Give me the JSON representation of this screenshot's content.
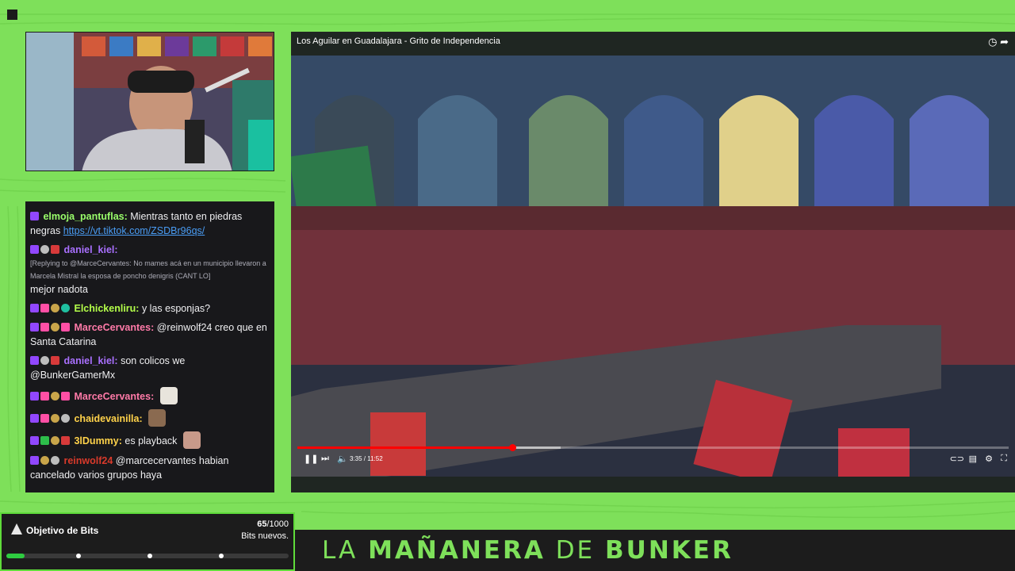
{
  "video": {
    "title": "Los Aguilar en Guadalajara - Grito de Independencia",
    "time": "3:35 / 11:52",
    "progress_fraction": 0.302,
    "buffered_fraction": 0.37
  },
  "chat": {
    "messages": [
      {
        "user": "elmoja_pantuflas:",
        "text": "Mientras tanto en piedras negras",
        "link": "https://vt.tiktok.com/ZSDBr96qs/",
        "color": "#9aff6b"
      },
      {
        "user": "daniel_kiel:",
        "reply": "[Replying to @MarceCervantes: No mames acá en un municipio llevaron a Marcela Mistral la esposa de poncho denigris (CANT LO]",
        "text": "mejor nadota",
        "color": "#a970ff"
      },
      {
        "user": "Elchickenliru:",
        "text": "y las esponjas?",
        "color": "#b4ff4a"
      },
      {
        "user": "MarceCervantes:",
        "text": "@reinwolf24 creo que en Santa Catarina",
        "color": "#ff7aa8"
      },
      {
        "user": "daniel_kiel:",
        "text": "son colicos we @BunkerGamerMx",
        "color": "#a970ff"
      },
      {
        "user": "MarceCervantes:",
        "text": "",
        "color": "#ff7aa8"
      },
      {
        "user": "chaidevainilla:",
        "text": "",
        "color": "#ffd24a"
      },
      {
        "user": "3lDummy:",
        "text": "es playback",
        "color": "#ffd24a"
      },
      {
        "user": "reinwolf24",
        "text": "@marcecervantes habian cancelado varios grupos haya",
        "color": "#d93a2b"
      }
    ]
  },
  "bits": {
    "title": "Objetivo de Bits",
    "current": "65",
    "goal": "/1000",
    "subtitle": "Bits nuevos.",
    "fraction": 0.065
  },
  "banner": {
    "word1": "LA",
    "word2": "MAÑANERA",
    "word3": "DE",
    "word4": "BUNKER"
  },
  "colors": {
    "background": "#7ee05a",
    "panel": "#18181b",
    "accent_green": "#2ecc40"
  }
}
